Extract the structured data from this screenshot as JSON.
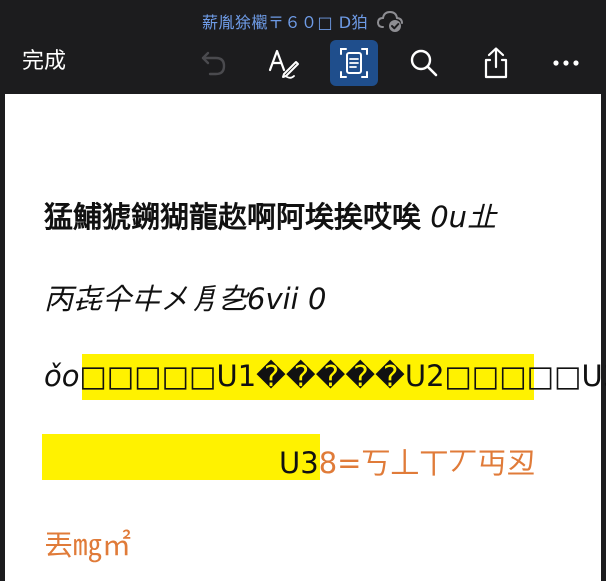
{
  "toolbar": {
    "document_title": "薪胤狳欟〒６０□ D狛",
    "done_label": "完成",
    "icons": {
      "sync_status": "cloud-check-icon",
      "undo": "undo-icon",
      "ink": "pen-ink-icon",
      "layout": "document-view-icon",
      "search": "search-icon",
      "share": "share-icon",
      "more": "more-icon"
    },
    "colors": {
      "background": "#1c1c1e",
      "title": "#6e9be6",
      "active_tool": "#1f4e8c"
    }
  },
  "document": {
    "line1_bold": "猛鯆猇鎙猢龍赼啊阿埃挨哎唉",
    "line1_italic": "0u㐀",
    "line2_italic": "丙㐂仐㐄㐅㐆㐇6vii 0",
    "line3_prefix": "ǒo",
    "line3_highlighted": "□□□□□U1�����U2□□□□□U3",
    "line4_highlighted_end": "U3",
    "line4_orange": "8=丂丄丅丆丏丒",
    "line5_orange": "丟㎎㎡",
    "colors": {
      "highlight": "#fff200",
      "orange_text": "#e07b39"
    }
  }
}
